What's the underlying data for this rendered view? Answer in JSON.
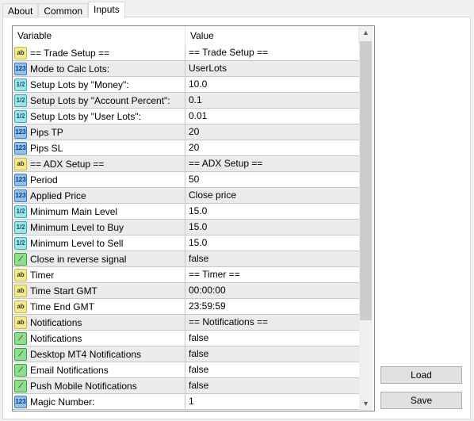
{
  "tabs": [
    {
      "label": "About"
    },
    {
      "label": "Common"
    },
    {
      "label": "Inputs",
      "active": true
    }
  ],
  "columns": {
    "variable": "Variable",
    "value": "Value"
  },
  "rows": [
    {
      "type": "string",
      "icon": "ab",
      "variable": "== Trade Setup ==",
      "value": "== Trade Setup =="
    },
    {
      "type": "int",
      "icon": "123",
      "variable": "Mode to Calc Lots:",
      "value": "UserLots"
    },
    {
      "type": "double",
      "icon": "1/2",
      "variable": "Setup Lots by \"Money\":",
      "value": "10.0"
    },
    {
      "type": "double",
      "icon": "1/2",
      "variable": "Setup Lots by \"Account Percent\":",
      "value": "0.1"
    },
    {
      "type": "double",
      "icon": "1/2",
      "variable": "Setup Lots by \"User Lots\":",
      "value": "0.01"
    },
    {
      "type": "int",
      "icon": "123",
      "variable": "Pips TP",
      "value": "20"
    },
    {
      "type": "int",
      "icon": "123",
      "variable": "Pips SL",
      "value": "20"
    },
    {
      "type": "string",
      "icon": "ab",
      "variable": "== ADX Setup ==",
      "value": "== ADX Setup =="
    },
    {
      "type": "int",
      "icon": "123",
      "variable": "Period",
      "value": "50"
    },
    {
      "type": "int",
      "icon": "123",
      "variable": "Applied Price",
      "value": "Close price"
    },
    {
      "type": "double",
      "icon": "1/2",
      "variable": "Minimum Main Level",
      "value": "15.0"
    },
    {
      "type": "double",
      "icon": "1/2",
      "variable": "Minimum Level to Buy",
      "value": "15.0"
    },
    {
      "type": "double",
      "icon": "1/2",
      "variable": "Minimum Level to Sell",
      "value": "15.0"
    },
    {
      "type": "bool",
      "icon": "~",
      "variable": "Close in reverse signal",
      "value": "false"
    },
    {
      "type": "string",
      "icon": "ab",
      "variable": "Timer",
      "value": "== Timer =="
    },
    {
      "type": "string",
      "icon": "ab",
      "variable": "Time Start GMT",
      "value": "00:00:00"
    },
    {
      "type": "string",
      "icon": "ab",
      "variable": "Time End GMT",
      "value": "23:59:59"
    },
    {
      "type": "string",
      "icon": "ab",
      "variable": "Notifications",
      "value": "== Notifications =="
    },
    {
      "type": "bool",
      "icon": "~",
      "variable": "Notifications",
      "value": "false"
    },
    {
      "type": "bool",
      "icon": "~",
      "variable": "Desktop MT4 Notifications",
      "value": "false"
    },
    {
      "type": "bool",
      "icon": "~",
      "variable": "Email Notifications",
      "value": "false"
    },
    {
      "type": "bool",
      "icon": "~",
      "variable": "Push Mobile Notifications",
      "value": "false"
    },
    {
      "type": "int",
      "icon": "123",
      "variable": "Magic Number:",
      "value": "1"
    }
  ],
  "buttons": {
    "load": "Load",
    "save": "Save"
  },
  "scrollbar": {
    "position_fraction": 0
  }
}
